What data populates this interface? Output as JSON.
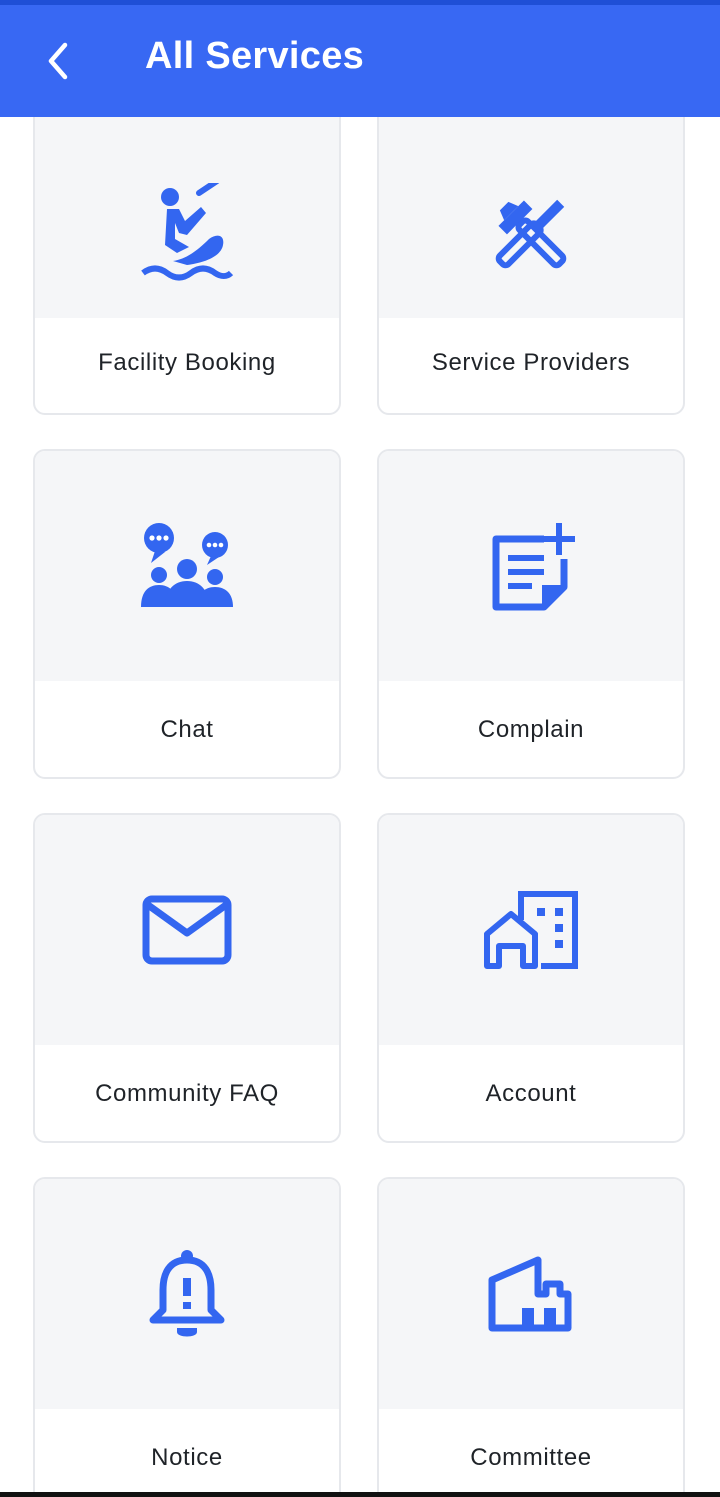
{
  "colors": {
    "accent": "#3868F3",
    "tile": "#F5F6F8",
    "icon": "#3366F0"
  },
  "header": {
    "title": "All Services",
    "back_icon": "chevron-left-icon"
  },
  "services": [
    {
      "label": "Facility Booking",
      "icon": "jet-ski-icon"
    },
    {
      "label": "Service Providers",
      "icon": "tools-icon"
    },
    {
      "label": "Chat",
      "icon": "group-chat-icon"
    },
    {
      "label": "Complain",
      "icon": "note-add-icon"
    },
    {
      "label": "Community FAQ",
      "icon": "mail-icon"
    },
    {
      "label": "Account",
      "icon": "home-building-icon"
    },
    {
      "label": "Notice",
      "icon": "alert-bell-icon"
    },
    {
      "label": "Committee",
      "icon": "factory-building-icon"
    }
  ]
}
